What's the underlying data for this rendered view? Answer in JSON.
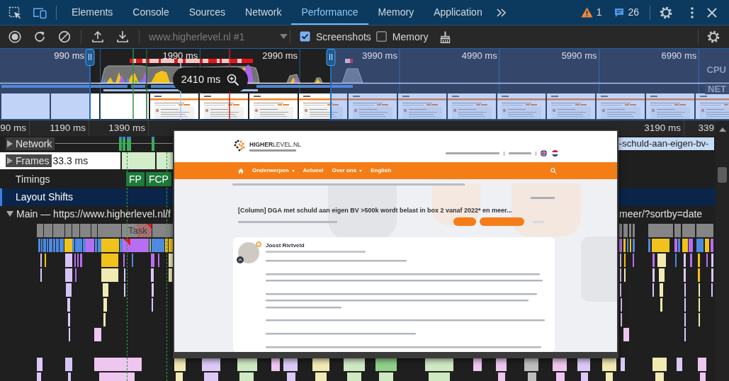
{
  "tabbar": {
    "device_toolbar_on": true,
    "tabs": [
      {
        "label": "Elements",
        "selected": false
      },
      {
        "label": "Console",
        "selected": false
      },
      {
        "label": "Sources",
        "selected": false
      },
      {
        "label": "Network",
        "selected": false
      },
      {
        "label": "Performance",
        "selected": true
      },
      {
        "label": "Memory",
        "selected": false
      },
      {
        "label": "Application",
        "selected": false
      }
    ],
    "warnings": "1",
    "messages": "26"
  },
  "toolbar": {
    "recording_target": {
      "value": "www.higherlevel.nl #1",
      "disabled": true
    },
    "options": [
      {
        "label": "Screenshots",
        "checked": true
      },
      {
        "label": "Memory",
        "checked": false
      }
    ]
  },
  "overview": {
    "time_labels": [
      "990 ms",
      "1990 ms",
      "2990 ms",
      "3990 ms",
      "4990 ms",
      "5990 ms",
      "6990 ms"
    ],
    "lanes": [
      "CPU",
      "NET"
    ],
    "hover_time": "2410 ms"
  },
  "ruler": {
    "left_ticks": [
      "90 ms",
      "1190 ms",
      "1390 ms"
    ],
    "right_ticks": [
      "3190 ms",
      "339"
    ]
  },
  "tracks": [
    {
      "kind": "network",
      "label": "Network",
      "expanded": false,
      "selected": false,
      "request_label": "-schuld-aan-eigen-bv-"
    },
    {
      "kind": "frames",
      "label": "Frames",
      "expanded": false,
      "selected": false,
      "frame_time": "33.3 ms"
    },
    {
      "kind": "timings",
      "label": "Timings",
      "selected": false,
      "markers": [
        "FP",
        "FCP"
      ]
    },
    {
      "kind": "layout_shifts",
      "label": "Layout Shifts",
      "selected": true
    },
    {
      "kind": "main",
      "label": "Main — https://www.higherlevel.nl/f",
      "expanded": true,
      "selected": false,
      "label_tail": "meer/?sortby=date"
    }
  ],
  "flame_chart": {
    "task_label": "Task"
  },
  "screenshot_popup": {
    "logo": "**HIGHER**LEVEL.NL",
    "nav": [
      {
        "label": "Onderwerpen",
        "dropdown": true
      },
      {
        "label": "Actueel",
        "dropdown": false
      },
      {
        "label": "Over ons",
        "dropdown": true
      },
      {
        "label": "English",
        "dropdown": false
      }
    ],
    "title": "[Column] DGA met schuld aan eigen BV >500k wordt belast in box 2 vanaf 2022* en meer...",
    "author": "Joost Rietveld"
  }
}
